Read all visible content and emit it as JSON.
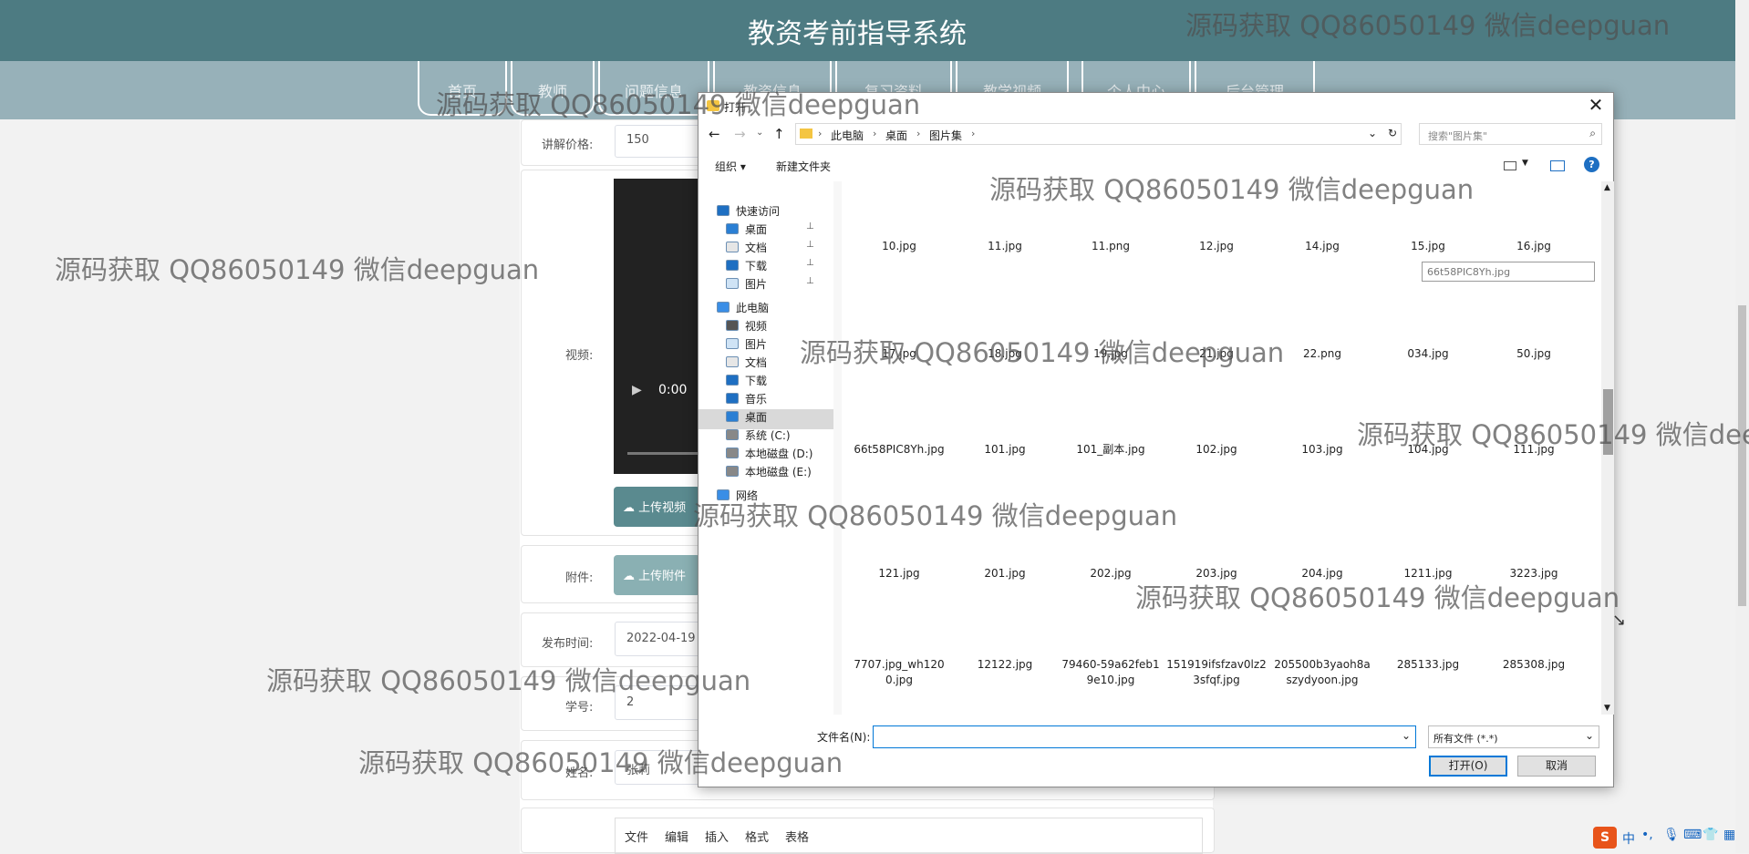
{
  "app": {
    "title": "教资考前指导系统"
  },
  "nav": {
    "items": [
      "首页",
      "教师",
      "问题信息",
      "教资信息",
      "复习资料",
      "教学视频",
      "个人中心",
      "后台管理"
    ]
  },
  "form": {
    "price_label": "讲解价格:",
    "price_value": "150",
    "video_label": "视频:",
    "video_time": "0:00",
    "upload_video": "上传视频",
    "attach_label": "附件:",
    "upload_attach": "上传附件",
    "date_label": "发布时间:",
    "date_value": "2022-04-19",
    "student_label": "学号:",
    "student_value": "2",
    "name_label": "姓名:",
    "name_value": "张莉",
    "editor_menu": [
      "文件",
      "编辑",
      "插入",
      "格式",
      "表格"
    ]
  },
  "dialog": {
    "title": "打开",
    "breadcrumb": [
      "此电脑",
      "桌面",
      "图片集"
    ],
    "search_placeholder": "搜索\"图片集\"",
    "organize": "组织 ▾",
    "new_folder": "新建文件夹",
    "rename_value": "66t58PIC8Yh.jpg",
    "sidebar": [
      {
        "label": "快速访问",
        "icon": "star-icon",
        "level": 0
      },
      {
        "label": "桌面",
        "icon": "desktop-icon",
        "level": 1,
        "pinned": true
      },
      {
        "label": "文档",
        "icon": "document-icon",
        "level": 1,
        "pinned": true
      },
      {
        "label": "下载",
        "icon": "download-icon",
        "level": 1,
        "pinned": true
      },
      {
        "label": "图片",
        "icon": "picture-icon",
        "level": 1,
        "pinned": true
      },
      {
        "label": "此电脑",
        "icon": "computer-icon",
        "level": 0
      },
      {
        "label": "视频",
        "icon": "video-icon",
        "level": 1
      },
      {
        "label": "图片",
        "icon": "picture-icon",
        "level": 1
      },
      {
        "label": "文档",
        "icon": "document-icon",
        "level": 1
      },
      {
        "label": "下载",
        "icon": "download-icon",
        "level": 1
      },
      {
        "label": "音乐",
        "icon": "music-icon",
        "level": 1
      },
      {
        "label": "桌面",
        "icon": "desktop-icon",
        "level": 1,
        "selected": true
      },
      {
        "label": "系统 (C:)",
        "icon": "drive-icon",
        "level": 1
      },
      {
        "label": "本地磁盘 (D:)",
        "icon": "drive-icon",
        "level": 1
      },
      {
        "label": "本地磁盘 (E:)",
        "icon": "drive-icon",
        "level": 1
      },
      {
        "label": "网络",
        "icon": "network-icon",
        "level": 0
      }
    ],
    "file_rows": [
      [
        "10.jpg",
        "11.jpg",
        "11.png",
        "12.jpg",
        "14.jpg",
        "15.jpg",
        "16.jpg"
      ],
      [
        "17.jpg",
        "18.jpg",
        "19.jpg",
        "21.jpg",
        "22.png",
        "034.jpg",
        "50.jpg"
      ],
      [
        "66t58PIC8Yh.jpg",
        "101.jpg",
        "101_副本.jpg",
        "102.jpg",
        "103.jpg",
        "104.jpg",
        "111.jpg"
      ],
      [
        "121.jpg",
        "201.jpg",
        "202.jpg",
        "203.jpg",
        "204.jpg",
        "1211.jpg",
        "3223.jpg"
      ],
      [
        "7707.jpg_wh1200.jpg",
        "12122.jpg",
        "79460-59a62feb19e10.jpg",
        "151919ifsfzav0lz23sfqf.jpg",
        "205500b3yaoh8aszydyoon.jpg",
        "285133.jpg",
        "285308.jpg"
      ]
    ],
    "filename_label": "文件名(N):",
    "filetype": "所有文件 (*.*)",
    "open": "打开(O)",
    "cancel": "取消"
  },
  "watermark": "源码获取 QQ86050149 微信deepguan",
  "ime": {
    "lang": "中"
  }
}
